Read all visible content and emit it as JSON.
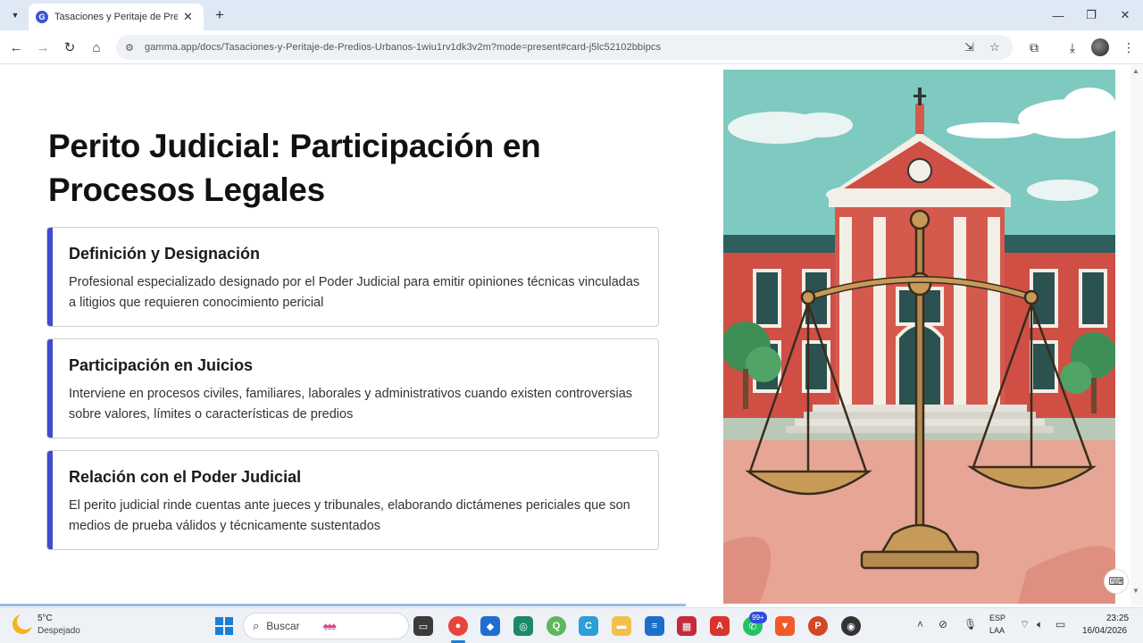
{
  "browser": {
    "tab_title": "Tasaciones y Peritaje de Predios",
    "favicon_letter": "G",
    "url": "gamma.app/docs/Tasaciones-y-Peritaje-de-Predios-Urbanos-1wiu1rv1dk3v2m?mode=present#card-j5lc52102bbipcs",
    "icons": [
      "tab-search-icon",
      "close-icon",
      "new-tab-icon",
      "minimize-icon",
      "maximize-icon",
      "window-close-icon",
      "back-icon",
      "forward-icon",
      "reload-icon",
      "home-icon",
      "site-info-icon",
      "install-app-icon",
      "star-icon",
      "extensions-icon",
      "download-icon"
    ]
  },
  "slide": {
    "title": "Perito Judicial: Participación en Procesos Legales",
    "accent": "#3f4bd0",
    "cards": [
      {
        "title": "Definición y Designación",
        "body": "Profesional especializado designado por el Poder Judicial para emitir opiniones técnicas vinculadas a litigios que requieren conocimiento pericial"
      },
      {
        "title": "Participación en Juicios",
        "body": "Interviene en procesos civiles, familiares, laborales y administrativos cuando existen controversias sobre valores, límites o características de predios"
      },
      {
        "title": "Relación con el Poder Judicial",
        "body": "El perito judicial rinde cuentas ante jueces y tribunales, elaborando dictámenes periciales que son medios de prueba válidos y técnicamente sustentados"
      }
    ],
    "illustration": "courthouse-with-scales-of-justice"
  },
  "taskbar": {
    "weather_temp": "5°C",
    "weather_desc": "Despejado",
    "search_placeholder": "Buscar",
    "notification_badge": "99+",
    "lang_primary": "ESP",
    "lang_secondary": "LAA",
    "time": "23:25",
    "date": "16/04/2026"
  }
}
